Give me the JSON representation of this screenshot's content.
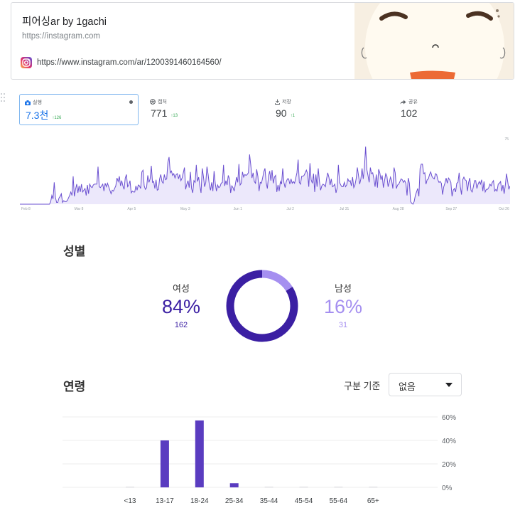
{
  "link_card": {
    "title": "피어싱ar by 1gachi",
    "site": "https://instagram.com",
    "url": "https://www.instagram.com/ar/1200391460164560/"
  },
  "metrics": [
    {
      "label": "실행",
      "value": "7.3천",
      "delta": "126",
      "icon": "camera-icon"
    },
    {
      "label": "캡처",
      "value": "771",
      "delta": "13",
      "icon": "aperture-icon"
    },
    {
      "label": "저장",
      "value": "90",
      "delta": "1",
      "icon": "save-icon"
    },
    {
      "label": "공유",
      "value": "102",
      "delta": "",
      "icon": "share-icon"
    }
  ],
  "trend_chart": {
    "y_max_label": "75",
    "x_labels": [
      "Feb 8",
      "Mar 8",
      "Apr 5",
      "May 3",
      "Jun 1",
      "Jul 2",
      "Jul 31",
      "Aug 28",
      "Sep 27",
      "Oct 26"
    ],
    "values": [
      0,
      0,
      0,
      0,
      0,
      0,
      0,
      0,
      0,
      0,
      0,
      0,
      0,
      0,
      0,
      0,
      0,
      0,
      0,
      0,
      0,
      0,
      0,
      0,
      0,
      0,
      3,
      10,
      6,
      25,
      8,
      2,
      2,
      7,
      9,
      12,
      2,
      4,
      3,
      3,
      4,
      7,
      10,
      14,
      10,
      32,
      9,
      17,
      23,
      13,
      21,
      14,
      23,
      14,
      16,
      18,
      10,
      22,
      12,
      23,
      20,
      19,
      22,
      23,
      23,
      23,
      43,
      20,
      19,
      21,
      23,
      15,
      24,
      20,
      24,
      20,
      16,
      12,
      16,
      15,
      18,
      21,
      30,
      26,
      32,
      21,
      27,
      21,
      17,
      30,
      34,
      20,
      22,
      27,
      13,
      15,
      14,
      14,
      21,
      16,
      22,
      21,
      18,
      37,
      39,
      21,
      17,
      19,
      33,
      25,
      29,
      44,
      25,
      26,
      18,
      28,
      16,
      17,
      29,
      34,
      26,
      24,
      34,
      28,
      29,
      48,
      54,
      36,
      38,
      33,
      35,
      30,
      34,
      35,
      29,
      34,
      27,
      30,
      36,
      42,
      17,
      23,
      27,
      19,
      37,
      18,
      13,
      27,
      25,
      45,
      26,
      31,
      21,
      13,
      41,
      32,
      20,
      25,
      43,
      34,
      22,
      16,
      25,
      15,
      38,
      24,
      15,
      22,
      19,
      20,
      24,
      25,
      45,
      21,
      27,
      22,
      33,
      29,
      13,
      21,
      19,
      15,
      23,
      31,
      25,
      46,
      22,
      24,
      37,
      31,
      34,
      33,
      34,
      36,
      57,
      45,
      30,
      36,
      26,
      24,
      40,
      32,
      15,
      25,
      24,
      30,
      37,
      41,
      25,
      18,
      32,
      38,
      27,
      39,
      24,
      31,
      33,
      14,
      22,
      15,
      26,
      23,
      41,
      25,
      19,
      26,
      29,
      29,
      23,
      29,
      24,
      26,
      24,
      30,
      36,
      51,
      25,
      23,
      32,
      32,
      33,
      36,
      39,
      35,
      20,
      47,
      28,
      24,
      35,
      14,
      34,
      20,
      41,
      26,
      16,
      21,
      23,
      22,
      20,
      29,
      36,
      31,
      22,
      29,
      20,
      21,
      23,
      13,
      19,
      45,
      25,
      22,
      20,
      20,
      25,
      20,
      22,
      29,
      26,
      27,
      21,
      31,
      19,
      22,
      29,
      42,
      33,
      23,
      29,
      41,
      29,
      42,
      66,
      40,
      33,
      25,
      42,
      35,
      36,
      29,
      20,
      34,
      19,
      40,
      36,
      28,
      33,
      19,
      27,
      35,
      32,
      20,
      25,
      31,
      27,
      18,
      42,
      36,
      18,
      22,
      23,
      26,
      29,
      28,
      25,
      27,
      24,
      10,
      30,
      24,
      3,
      1,
      0,
      3,
      10,
      14,
      18,
      9,
      41,
      46,
      46,
      35,
      36,
      23,
      28,
      29,
      34,
      37,
      32,
      30,
      29,
      35,
      34,
      28,
      25,
      26,
      24,
      11,
      20,
      24,
      30,
      24,
      30,
      28,
      25,
      9,
      16,
      18,
      14,
      24,
      25,
      36,
      20,
      11,
      28,
      31,
      28,
      27,
      15,
      25,
      30,
      16,
      14,
      20,
      27,
      27,
      18,
      23,
      26,
      23,
      28,
      15,
      26,
      14,
      17,
      17,
      19,
      23,
      21,
      25,
      27,
      15,
      17,
      15,
      23,
      24,
      26,
      15,
      22,
      12,
      22,
      35,
      26,
      17,
      21
    ]
  },
  "gender": {
    "title": "성별",
    "female": {
      "label": "여성",
      "pct": "84%",
      "count": "162",
      "value": 84,
      "color": "#3b1fa3"
    },
    "male": {
      "label": "남성",
      "pct": "16%",
      "count": "31",
      "value": 16,
      "color": "#a58ff0"
    }
  },
  "age": {
    "title": "연령",
    "filter_label": "구분 기준",
    "filter_value": "없음"
  },
  "chart_data": {
    "type": "bar",
    "categories": [
      "<13",
      "13-17",
      "18-24",
      "25-34",
      "35-44",
      "45-54",
      "55-64",
      "65+"
    ],
    "values": [
      0.3,
      40,
      57,
      3.5,
      0.3,
      0.3,
      0.3,
      0.3
    ],
    "ylim": [
      0,
      60
    ],
    "yticks": [
      "60%",
      "40%",
      "20%",
      "0%"
    ],
    "color": "#5a3cc0",
    "grid": true
  }
}
